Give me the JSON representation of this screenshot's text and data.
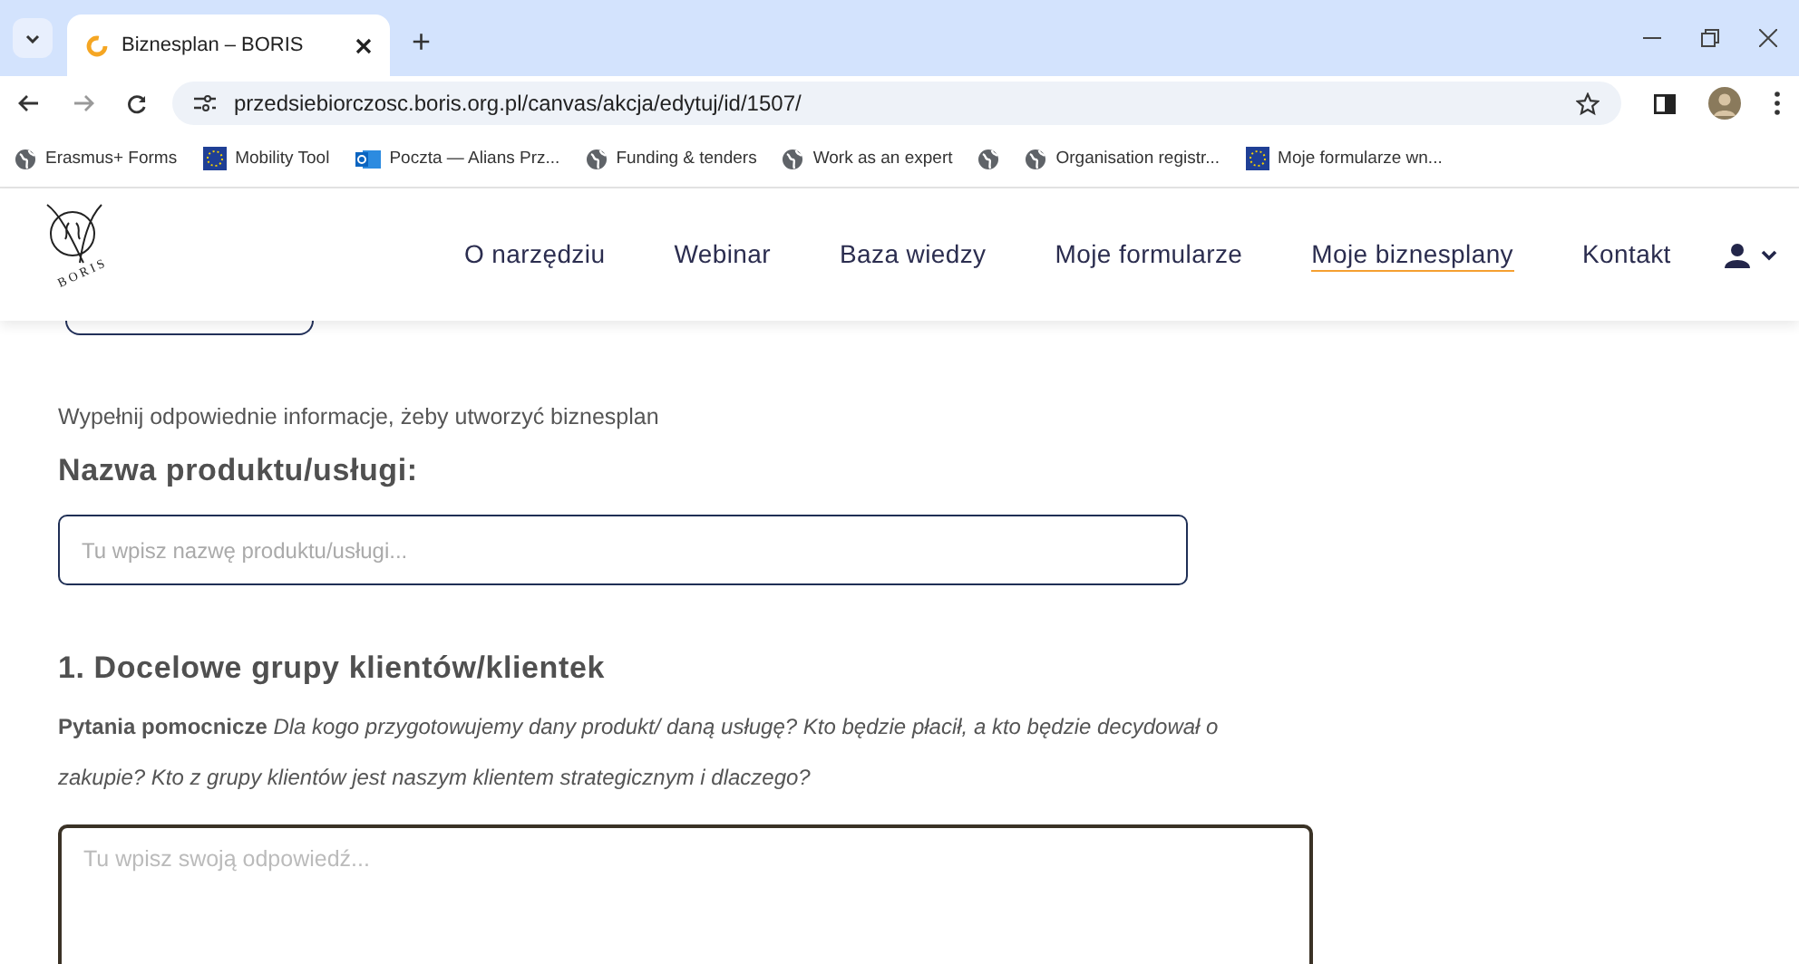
{
  "browser": {
    "tabs": [
      {
        "title": "Biznesplan – BORIS",
        "selected": true
      }
    ],
    "new_tab": "+",
    "address": "przedsiebiorczosc.boris.org.pl/canvas/akcja/edytuj/id/1507/",
    "bookmarks": [
      {
        "label": "Erasmus+ Forms",
        "kind": "globe"
      },
      {
        "label": "Mobility Tool",
        "kind": "flag"
      },
      {
        "label": "Poczta — Alians Prz...",
        "kind": "mail"
      },
      {
        "label": "Funding & tenders",
        "kind": "globe"
      },
      {
        "label": "Work as an expert",
        "kind": "globe"
      },
      {
        "kind": "globe"
      },
      {
        "label": "Organisation registr...",
        "kind": "globe"
      },
      {
        "label": "Moje formularze wn...",
        "kind": "flag"
      }
    ]
  },
  "site": {
    "logo_text": "B O R I S",
    "nav": [
      {
        "label": "O narzędziu",
        "selected": false
      },
      {
        "label": "Webinar",
        "selected": false
      },
      {
        "label": "Baza wiedzy",
        "selected": false
      },
      {
        "label": "Moje formularze",
        "selected": false
      },
      {
        "label": "Moje biznesplany",
        "selected": true
      },
      {
        "label": "Kontakt",
        "selected": false
      }
    ]
  },
  "form": {
    "intro": "Wypełnij odpowiednie informacje, żeby utworzyć biznesplan",
    "name_label": "Nazwa produktu/usługi:",
    "name_field": {
      "placeholder": "Tu wpisz nazwę produktu/usługi..."
    },
    "sections": [
      {
        "title": "1. Docelowe grupy klientów/klientek",
        "help": "**Pytania pomocnicze** *Dla kogo przygotowujemy dany produkt/ daną usługę? Kto będzie płacił, a kto będzie decydował o zakupie? Kto z grupy klientów jest naszym klientem strategicznym i dlaczego?*",
        "answer": {
          "placeholder": "Tu wpisz swoją odpowiedź..."
        }
      }
    ]
  }
}
